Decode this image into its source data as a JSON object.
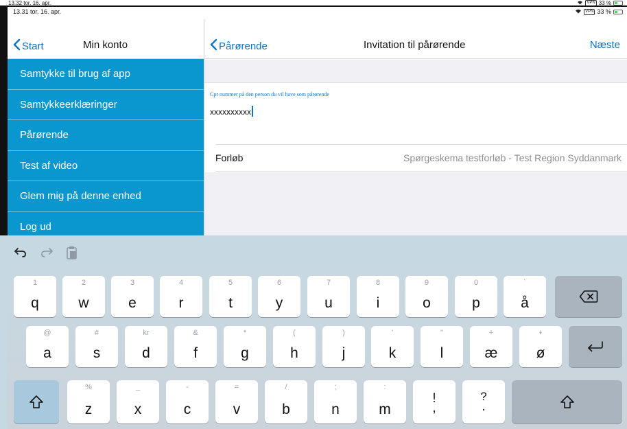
{
  "outer_status": {
    "time": "13.32  tor. 16. apr.",
    "vpn": "VPN",
    "battery": "33 %"
  },
  "inner_status": {
    "time": "13.31  tor. 16. apr.",
    "vpn": "VPN",
    "battery": "33 %"
  },
  "left_nav": {
    "back": "Start",
    "title": "Min konto"
  },
  "menu": {
    "items": [
      "Samtykke til brug af app",
      "Samtykkeerklæringer",
      "Pårørende",
      "Test af video",
      "Glem mig på denne enhed",
      "Log ud"
    ]
  },
  "right_nav": {
    "back": "Pårørende",
    "title": "Invitation til pårørende",
    "next": "Næste"
  },
  "form": {
    "cpr_label": "Cpr nummer på den person du vil have som pårørende",
    "cpr_value": "xxxxxxxxxx",
    "course_label": "Forløb",
    "course_value": "Spørgeskema testforløb - Test Region Syddanmark"
  },
  "keyboard": {
    "row1": [
      {
        "key": "q",
        "hint": "1"
      },
      {
        "key": "w",
        "hint": "2"
      },
      {
        "key": "e",
        "hint": "3"
      },
      {
        "key": "r",
        "hint": "4"
      },
      {
        "key": "t",
        "hint": "5"
      },
      {
        "key": "y",
        "hint": "6"
      },
      {
        "key": "u",
        "hint": "7"
      },
      {
        "key": "i",
        "hint": "8"
      },
      {
        "key": "o",
        "hint": "9"
      },
      {
        "key": "p",
        "hint": "0"
      },
      {
        "key": "å",
        "hint": "`"
      }
    ],
    "row2": [
      {
        "key": "a",
        "hint": "@"
      },
      {
        "key": "s",
        "hint": "#"
      },
      {
        "key": "d",
        "hint": "kr"
      },
      {
        "key": "f",
        "hint": "&"
      },
      {
        "key": "g",
        "hint": "*"
      },
      {
        "key": "h",
        "hint": "("
      },
      {
        "key": "j",
        "hint": ")"
      },
      {
        "key": "k",
        "hint": "'"
      },
      {
        "key": "l",
        "hint": "\""
      },
      {
        "key": "æ",
        "hint": "+"
      },
      {
        "key": "ø",
        "hint": "•"
      }
    ],
    "row3": [
      {
        "key": "z",
        "hint": "%"
      },
      {
        "key": "x",
        "hint": "_"
      },
      {
        "key": "c",
        "hint": "-"
      },
      {
        "key": "v",
        "hint": "="
      },
      {
        "key": "b",
        "hint": "/"
      },
      {
        "key": "n",
        "hint": ";"
      },
      {
        "key": "m",
        "hint": ":"
      }
    ],
    "punct1": {
      "top": "!",
      "bottom": ","
    },
    "punct2": {
      "top": "?",
      "bottom": "."
    }
  },
  "colors": {
    "accent": "#0a74c9",
    "menu_bg": "#0a97d0"
  }
}
